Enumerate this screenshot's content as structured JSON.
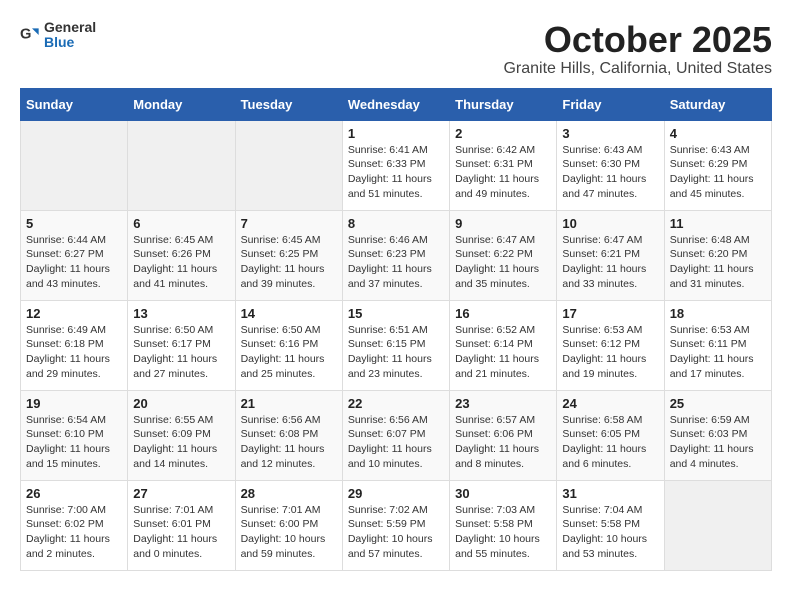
{
  "header": {
    "logo_general": "General",
    "logo_blue": "Blue",
    "title": "October 2025",
    "subtitle": "Granite Hills, California, United States"
  },
  "weekdays": [
    "Sunday",
    "Monday",
    "Tuesday",
    "Wednesday",
    "Thursday",
    "Friday",
    "Saturday"
  ],
  "weeks": [
    [
      {
        "day": "",
        "info": ""
      },
      {
        "day": "",
        "info": ""
      },
      {
        "day": "",
        "info": ""
      },
      {
        "day": "1",
        "info": "Sunrise: 6:41 AM\nSunset: 6:33 PM\nDaylight: 11 hours\nand 51 minutes."
      },
      {
        "day": "2",
        "info": "Sunrise: 6:42 AM\nSunset: 6:31 PM\nDaylight: 11 hours\nand 49 minutes."
      },
      {
        "day": "3",
        "info": "Sunrise: 6:43 AM\nSunset: 6:30 PM\nDaylight: 11 hours\nand 47 minutes."
      },
      {
        "day": "4",
        "info": "Sunrise: 6:43 AM\nSunset: 6:29 PM\nDaylight: 11 hours\nand 45 minutes."
      }
    ],
    [
      {
        "day": "5",
        "info": "Sunrise: 6:44 AM\nSunset: 6:27 PM\nDaylight: 11 hours\nand 43 minutes."
      },
      {
        "day": "6",
        "info": "Sunrise: 6:45 AM\nSunset: 6:26 PM\nDaylight: 11 hours\nand 41 minutes."
      },
      {
        "day": "7",
        "info": "Sunrise: 6:45 AM\nSunset: 6:25 PM\nDaylight: 11 hours\nand 39 minutes."
      },
      {
        "day": "8",
        "info": "Sunrise: 6:46 AM\nSunset: 6:23 PM\nDaylight: 11 hours\nand 37 minutes."
      },
      {
        "day": "9",
        "info": "Sunrise: 6:47 AM\nSunset: 6:22 PM\nDaylight: 11 hours\nand 35 minutes."
      },
      {
        "day": "10",
        "info": "Sunrise: 6:47 AM\nSunset: 6:21 PM\nDaylight: 11 hours\nand 33 minutes."
      },
      {
        "day": "11",
        "info": "Sunrise: 6:48 AM\nSunset: 6:20 PM\nDaylight: 11 hours\nand 31 minutes."
      }
    ],
    [
      {
        "day": "12",
        "info": "Sunrise: 6:49 AM\nSunset: 6:18 PM\nDaylight: 11 hours\nand 29 minutes."
      },
      {
        "day": "13",
        "info": "Sunrise: 6:50 AM\nSunset: 6:17 PM\nDaylight: 11 hours\nand 27 minutes."
      },
      {
        "day": "14",
        "info": "Sunrise: 6:50 AM\nSunset: 6:16 PM\nDaylight: 11 hours\nand 25 minutes."
      },
      {
        "day": "15",
        "info": "Sunrise: 6:51 AM\nSunset: 6:15 PM\nDaylight: 11 hours\nand 23 minutes."
      },
      {
        "day": "16",
        "info": "Sunrise: 6:52 AM\nSunset: 6:14 PM\nDaylight: 11 hours\nand 21 minutes."
      },
      {
        "day": "17",
        "info": "Sunrise: 6:53 AM\nSunset: 6:12 PM\nDaylight: 11 hours\nand 19 minutes."
      },
      {
        "day": "18",
        "info": "Sunrise: 6:53 AM\nSunset: 6:11 PM\nDaylight: 11 hours\nand 17 minutes."
      }
    ],
    [
      {
        "day": "19",
        "info": "Sunrise: 6:54 AM\nSunset: 6:10 PM\nDaylight: 11 hours\nand 15 minutes."
      },
      {
        "day": "20",
        "info": "Sunrise: 6:55 AM\nSunset: 6:09 PM\nDaylight: 11 hours\nand 14 minutes."
      },
      {
        "day": "21",
        "info": "Sunrise: 6:56 AM\nSunset: 6:08 PM\nDaylight: 11 hours\nand 12 minutes."
      },
      {
        "day": "22",
        "info": "Sunrise: 6:56 AM\nSunset: 6:07 PM\nDaylight: 11 hours\nand 10 minutes."
      },
      {
        "day": "23",
        "info": "Sunrise: 6:57 AM\nSunset: 6:06 PM\nDaylight: 11 hours\nand 8 minutes."
      },
      {
        "day": "24",
        "info": "Sunrise: 6:58 AM\nSunset: 6:05 PM\nDaylight: 11 hours\nand 6 minutes."
      },
      {
        "day": "25",
        "info": "Sunrise: 6:59 AM\nSunset: 6:03 PM\nDaylight: 11 hours\nand 4 minutes."
      }
    ],
    [
      {
        "day": "26",
        "info": "Sunrise: 7:00 AM\nSunset: 6:02 PM\nDaylight: 11 hours\nand 2 minutes."
      },
      {
        "day": "27",
        "info": "Sunrise: 7:01 AM\nSunset: 6:01 PM\nDaylight: 11 hours\nand 0 minutes."
      },
      {
        "day": "28",
        "info": "Sunrise: 7:01 AM\nSunset: 6:00 PM\nDaylight: 10 hours\nand 59 minutes."
      },
      {
        "day": "29",
        "info": "Sunrise: 7:02 AM\nSunset: 5:59 PM\nDaylight: 10 hours\nand 57 minutes."
      },
      {
        "day": "30",
        "info": "Sunrise: 7:03 AM\nSunset: 5:58 PM\nDaylight: 10 hours\nand 55 minutes."
      },
      {
        "day": "31",
        "info": "Sunrise: 7:04 AM\nSunset: 5:58 PM\nDaylight: 10 hours\nand 53 minutes."
      },
      {
        "day": "",
        "info": ""
      }
    ]
  ]
}
